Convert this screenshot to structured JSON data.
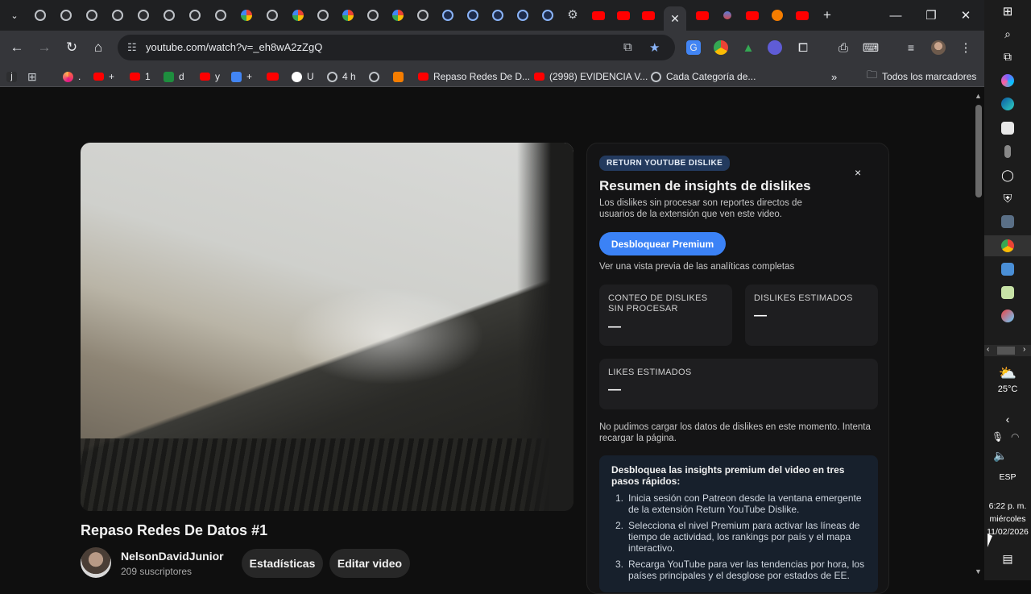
{
  "browser": {
    "url": "youtube.com/watch?v=_eh8wA2zZgQ",
    "bookmarks": [
      {
        "label": ".",
        "icon": "firefox-icon"
      },
      {
        "label": "+",
        "icon": "youtube-icon"
      },
      {
        "label": "1",
        "icon": "youtube-icon"
      },
      {
        "label": "d",
        "icon": "classroom-icon"
      },
      {
        "label": "y",
        "icon": "youtube-icon"
      },
      {
        "label": "+",
        "icon": "translate-icon"
      },
      {
        "label": "",
        "icon": "youtube-icon"
      },
      {
        "label": "U",
        "icon": "grammarly-icon"
      },
      {
        "label": "4 h",
        "icon": "globe-icon"
      },
      {
        "label": "",
        "icon": "globe-icon"
      },
      {
        "label": "",
        "icon": "blogger-icon"
      },
      {
        "label": "Repaso Redes De D...",
        "icon": "youtube-icon"
      },
      {
        "label": "(2998) EVIDENCIA V...",
        "icon": "youtube-icon"
      },
      {
        "label": "Cada Categoría de...",
        "icon": "globe-icon"
      }
    ],
    "all_bookmarks_label": "Todos los marcadores"
  },
  "video": {
    "title": "Repaso Redes De Datos #1",
    "channel": "NelsonDavidJunior",
    "subscribers": "209 suscriptores",
    "stats_button": "Estadísticas",
    "edit_button": "Editar video"
  },
  "panel": {
    "badge": "RETURN YOUTUBE DISLIKE",
    "close": "×",
    "title": "Resumen de insights de dislikes",
    "description": "Los dislikes sin procesar son reportes directos de usuarios de la extensión que ven este video.",
    "premium_button": "Desbloquear Premium",
    "preview_note": "Ver una vista previa de las analíticas completas",
    "stats": [
      {
        "label": "CONTEO DE DISLIKES SIN PROCESAR",
        "value": "—"
      },
      {
        "label": "DISLIKES ESTIMADOS",
        "value": "—"
      },
      {
        "label": "LIKES ESTIMADOS",
        "value": "—"
      }
    ],
    "error": "No pudimos cargar los datos de dislikes en este momento. Intenta recargar la página.",
    "steps_title": "Desbloquea las insights premium del video en tres pasos rápidos:",
    "steps": [
      {
        "num": "1.",
        "text": "Inicia sesión con Patreon desde la ventana emergente de la extensión Return YouTube Dislike."
      },
      {
        "num": "2.",
        "text": "Selecciona el nivel Premium para activar las líneas de tiempo de actividad, los rankings por país y el mapa interactivo."
      },
      {
        "num": "3.",
        "text": "Recarga YouTube para ver las tendencias por hora, los países principales y el desglose por estados de EE."
      }
    ]
  },
  "taskbar": {
    "weather_temp": "25°C",
    "language": "ESP",
    "time": "6:22 p. m.",
    "day": "miércoles",
    "date": "11/02/2026"
  }
}
